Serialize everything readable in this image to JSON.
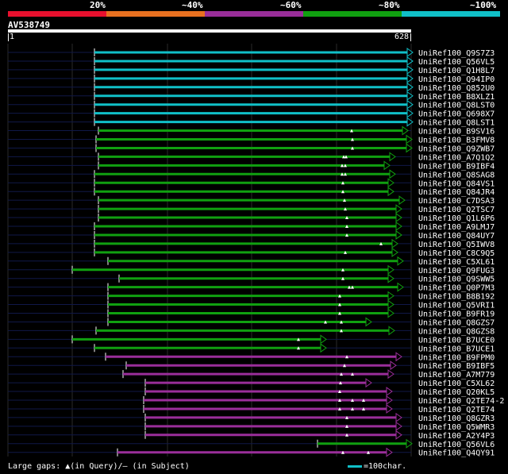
{
  "scale": {
    "labels": [
      "20%",
      "~40%",
      "~60%",
      "~80%",
      "~100%"
    ],
    "colors": [
      "#e8102e",
      "#e87020",
      "#9a2e9a",
      "#10a010",
      "#10c0c8"
    ]
  },
  "query": {
    "name": "AV538749",
    "start": "1",
    "end": "628"
  },
  "footer": {
    "gaps_text": "Large gaps: ▲(in Query)/– (in Subject)",
    "legend_text": "=100char."
  },
  "hits": [
    {
      "label": "UniRef100_Q9S7Z3",
      "group": 4
    },
    {
      "label": "UniRef100_Q56VL5",
      "group": 4
    },
    {
      "label": "UniRef100_Q1H8L7",
      "group": 4
    },
    {
      "label": "UniRef100_Q94IP0",
      "group": 4
    },
    {
      "label": "UniRef100_Q852U0",
      "group": 4
    },
    {
      "label": "UniRef100_B8XLZ1",
      "group": 4
    },
    {
      "label": "UniRef100_Q8LST0",
      "group": 4
    },
    {
      "label": "UniRef100_Q698X7",
      "group": 4
    },
    {
      "label": "UniRef100_Q8LST1",
      "group": 4
    },
    {
      "label": "UniRef100_B9SV16",
      "group": 3
    },
    {
      "label": "UniRef100_B3FMV8",
      "group": 3
    },
    {
      "label": "UniRef100_Q9ZWB7",
      "group": 3
    },
    {
      "label": "UniRef100_A7Q1Q2",
      "group": 3
    },
    {
      "label": "UniRef100_B9IBF4",
      "group": 3
    },
    {
      "label": "UniRef100_Q8SAG8",
      "group": 3
    },
    {
      "label": "UniRef100_Q84VS1",
      "group": 3
    },
    {
      "label": "UniRef100_Q84JR4",
      "group": 3
    },
    {
      "label": "UniRef100_C7DSA3",
      "group": 3
    },
    {
      "label": "UniRef100_Q2TSC7",
      "group": 3
    },
    {
      "label": "UniRef100_Q1L6P6",
      "group": 3
    },
    {
      "label": "UniRef100_A9LMJ7",
      "group": 3
    },
    {
      "label": "UniRef100_Q84UY7",
      "group": 3
    },
    {
      "label": "UniRef100_Q5IWV8",
      "group": 3
    },
    {
      "label": "UniRef100_C8C9Q5",
      "group": 3
    },
    {
      "label": "UniRef100_C5XL61",
      "group": 3
    },
    {
      "label": "UniRef100_Q9FUG3",
      "group": 3
    },
    {
      "label": "UniRef100_Q9SWW5",
      "group": 3
    },
    {
      "label": "UniRef100_Q0P7M3",
      "group": 3
    },
    {
      "label": "UniRef100_B8B192",
      "group": 3
    },
    {
      "label": "UniRef100_Q5VRI1",
      "group": 3
    },
    {
      "label": "UniRef100_B9FR19",
      "group": 3
    },
    {
      "label": "UniRef100_Q8GZS7",
      "group": 3
    },
    {
      "label": "UniRef100_Q8GZS8",
      "group": 3
    },
    {
      "label": "UniRef100_B7UCE0",
      "group": 3
    },
    {
      "label": "UniRef100_B7UCE1",
      "group": 3
    },
    {
      "label": "UniRef100_B9FPM0",
      "group": 2
    },
    {
      "label": "UniRef100_B9IBF5",
      "group": 2
    },
    {
      "label": "UniRef100_A7M779",
      "group": 2
    },
    {
      "label": "UniRef100_C5XL62",
      "group": 2
    },
    {
      "label": "UniRef100_Q20KL5",
      "group": 2
    },
    {
      "label": "UniRef100_Q2TE74-2",
      "group": 2
    },
    {
      "label": "UniRef100_Q2TE74",
      "group": 2
    },
    {
      "label": "UniRef100_Q8GZR3",
      "group": 2
    },
    {
      "label": "UniRef100_Q5WMR3",
      "group": 2
    },
    {
      "label": "UniRef100_A2Y4P3",
      "group": 2
    },
    {
      "label": "UniRef100_Q56VL6",
      "group": 3
    },
    {
      "label": "UniRef100_Q4QY91",
      "group": 2
    }
  ]
}
